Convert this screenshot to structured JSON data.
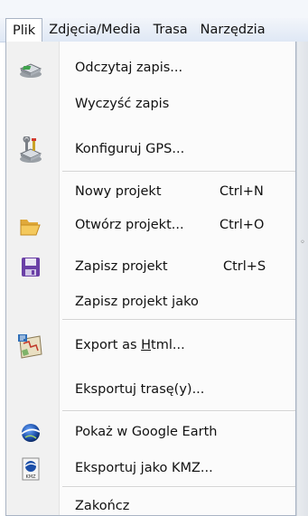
{
  "menubar": {
    "items": [
      {
        "label": "Plik"
      },
      {
        "label": "Zdjęcia/Media"
      },
      {
        "label": "Trasa"
      },
      {
        "label": "Narzędzia"
      }
    ]
  },
  "menu": {
    "items": [
      {
        "label": "Odczytaj zapis...",
        "icon": "gps-device-icon"
      },
      {
        "label": "Wyczyść zapis"
      },
      {
        "label": "Konfiguruj GPS...",
        "icon": "gps-configure-icon"
      },
      {
        "label": "Nowy projekt",
        "shortcut": "Ctrl+N"
      },
      {
        "label": "Otwórz projekt...",
        "shortcut": "Ctrl+O",
        "icon": "folder-open-icon"
      },
      {
        "label": "Zapisz projekt",
        "shortcut": "Ctrl+S",
        "icon": "save-icon"
      },
      {
        "label": "Zapisz projekt jako"
      },
      {
        "label_before": "Export as ",
        "label_underlined": "H",
        "label_after": "tml...",
        "icon": "html-map-icon"
      },
      {
        "label": "Eksportuj trasę(y)..."
      },
      {
        "label": "Pokaż w Google Earth",
        "icon": "google-earth-icon"
      },
      {
        "label": "Eksportuj jako KMZ...",
        "icon": "kmz-icon",
        "icon_text": "KMZ"
      },
      {
        "label": "Zakończ"
      }
    ]
  },
  "colors": {
    "menubar_bg": "#dfe8f5",
    "menu_bg": "#fbfbfb",
    "gutter_bg": "#f1f1f1",
    "separator": "#d4d4d4"
  }
}
